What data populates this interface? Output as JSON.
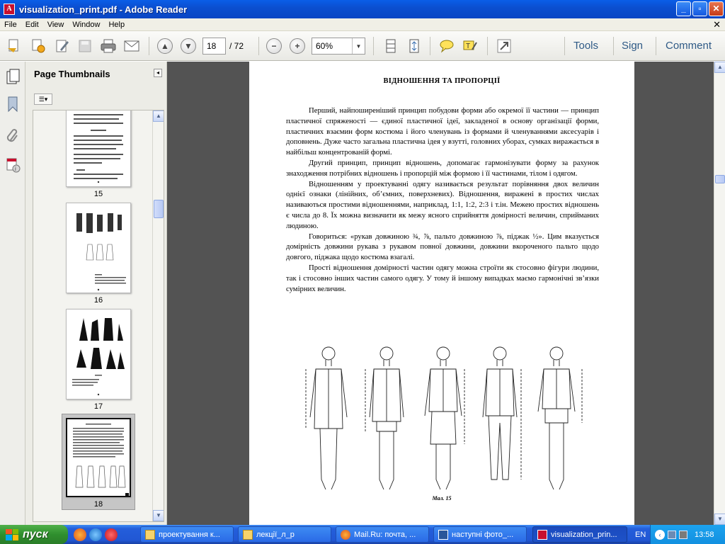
{
  "window": {
    "title": "visualization_print.pdf - Adobe Reader",
    "app_icon": "pdf-icon"
  },
  "menu": [
    "File",
    "Edit",
    "View",
    "Window",
    "Help"
  ],
  "toolbar": {
    "current_page": "18",
    "page_total": "/ 72",
    "zoom": "60%",
    "tools_label": "Tools",
    "sign_label": "Sign",
    "comment_label": "Comment"
  },
  "thumbnails": {
    "title": "Page Thumbnails",
    "pages": [
      {
        "label": "15"
      },
      {
        "label": "16"
      },
      {
        "label": "17"
      },
      {
        "label": "18",
        "selected": true
      }
    ]
  },
  "document": {
    "heading": "ВІДНОШЕННЯ ТА ПРОПОРЦІЇ",
    "paragraphs": [
      "Перший, найпоширеніший принцип побудови форми або окремої її частини — принцип пластичної спряженості — єдиної пластичної ідеї, закладеної в основу організації форми, пластичних взаємин форм костюма і його членувань із формами й членуваннями аксесуарів і доповнень. Дуже часто загальна пластична ідея у взутті, головних уборах, сумках виражається в найбільш концентрованій формі.",
      "Другий принцип, принцип відношень, допомагає гармонізувати форму за рахунок знаходження потрібних відношень і пропорцій між формою і її частинами, тілом і одягом.",
      "Відношенням у проектуванні одягу називається результат порівняння двох величин однієї ознаки (лінійних, об’ємних, поверхневих). Відношення, виражені в простих числах називаються простими відношеннями, наприклад, 1:1, 1:2, 2:3 і т.ін. Межею простих відношень є числа до 8. Їх можна визначити як межу ясного сприйняття домірності величин, сприйманих людиною.",
      "Говориться: «рукав довжиною ¾, ⅞, пальто довжиною ⅞, піджак ½». Цим вказується домірність довжини рукава з рукавом повної довжини, довжини вкороченого пальто щодо довгого, піджака щодо костюма взагалі.",
      "Прості відношення домірності частин одягу можна строїти як стосовно фігури людини, так і стосовно інших частин самого одягу. У тому й іншому випадках маємо гармонічні зв’язки сумірних величин."
    ],
    "figure_caption": "Мал. 15"
  },
  "taskbar": {
    "start_label": "пуск",
    "tasks": [
      {
        "label": "проектування к...",
        "icon": "folder-icon"
      },
      {
        "label": "лекції_л_р",
        "icon": "folder-icon"
      },
      {
        "label": "Mail.Ru: почта, ...",
        "icon": "firefox-icon"
      },
      {
        "label": "наступні фото_...",
        "icon": "word-icon"
      },
      {
        "label": "visualization_prin...",
        "icon": "pdf-icon",
        "active": true
      }
    ],
    "language": "EN",
    "clock": "13:58"
  },
  "colors": {
    "accent": "#2f5a86",
    "titlebar": "#0b4fd0",
    "viewer_bg": "#535353"
  }
}
